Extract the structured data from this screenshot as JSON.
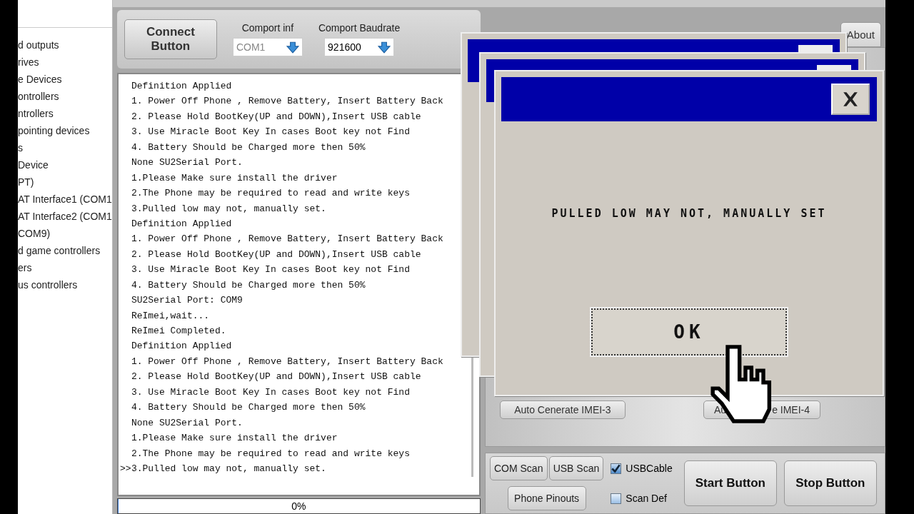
{
  "device_manager": {
    "items": [
      "d outputs",
      "rives",
      "e Devices",
      "ontrollers",
      "ntrollers",
      "pointing devices",
      "s",
      "Device",
      "PT)",
      "AT Interface1 (COM1",
      "AT Interface2 (COM1",
      "COM9)",
      "d game controllers",
      "ers",
      "us controllers"
    ]
  },
  "toolbar": {
    "connect_button": "Connect Button",
    "comport": {
      "label": "Comport inf",
      "value": "COM1"
    },
    "baudrate": {
      "label": "Comport Baudrate",
      "value": "921600"
    }
  },
  "log": {
    "lines": [
      {
        "text": "Definition Applied"
      },
      {
        "text": "1. Power Off Phone , Remove Battery, Insert Battery Back"
      },
      {
        "text": "2. Please Hold BootKey(UP and DOWN),Insert USB cable"
      },
      {
        "text": "3. Use Miracle Boot Key In cases Boot key not Find"
      },
      {
        "text": "4. Battery Should be Charged more then 50%"
      },
      {
        "text": "None SU2Serial Port."
      },
      {
        "text": "1.Please Make sure install the driver"
      },
      {
        "text": "2.The Phone may be required to read and write keys"
      },
      {
        "text": "3.Pulled low may not, manually set."
      },
      {
        "text": "Definition Applied"
      },
      {
        "text": "1. Power Off Phone , Remove Battery, Insert Battery Back"
      },
      {
        "text": "2. Please Hold BootKey(UP and DOWN),Insert USB cable"
      },
      {
        "text": "3. Use Miracle Boot Key In cases Boot key not Find"
      },
      {
        "text": "4. Battery Should be Charged more then 50%"
      },
      {
        "text": "SU2Serial Port: COM9"
      },
      {
        "text": "ReImei,wait..."
      },
      {
        "text": "ReImei Completed."
      },
      {
        "text": "Definition Applied"
      },
      {
        "text": "1. Power Off Phone , Remove Battery, Insert Battery Back"
      },
      {
        "text": "2. Please Hold BootKey(UP and DOWN),Insert USB cable"
      },
      {
        "text": "3. Use Miracle Boot Key In cases Boot key not Find"
      },
      {
        "text": "4. Battery Should be Charged more then 50%"
      },
      {
        "text": "None SU2Serial Port."
      },
      {
        "text": "1.Please Make sure install the driver"
      },
      {
        "text": "2.The Phone may be required to read and write keys"
      },
      {
        "text": "3.Pulled low may not, manually set.",
        "prompt": ">>"
      }
    ]
  },
  "progress": {
    "label": "0%",
    "level": 0
  },
  "tabs": [
    {
      "label": "About",
      "selected": false
    }
  ],
  "imei_buttons": [
    {
      "parts": [
        "Auto Cenerate IMEI-3"
      ]
    },
    {
      "parts": [
        "Au",
        "e IMEI-4"
      ]
    }
  ],
  "bottom": {
    "scan_buttons": [
      "COM Scan",
      "USB Scan"
    ],
    "pinouts_button": "Phone Pinouts",
    "checkboxes": [
      {
        "label": "USBCable",
        "checked": true
      },
      {
        "label": "Scan Def",
        "checked": false
      }
    ],
    "start_button": "Start Button",
    "stop_button": "Stop Button"
  },
  "dialogs": [
    {
      "kind": "background"
    },
    {
      "kind": "background"
    },
    {
      "kind": "front",
      "message": "PULLED LOW MAY NOT, MANUALLY SET",
      "button": "OK"
    }
  ]
}
